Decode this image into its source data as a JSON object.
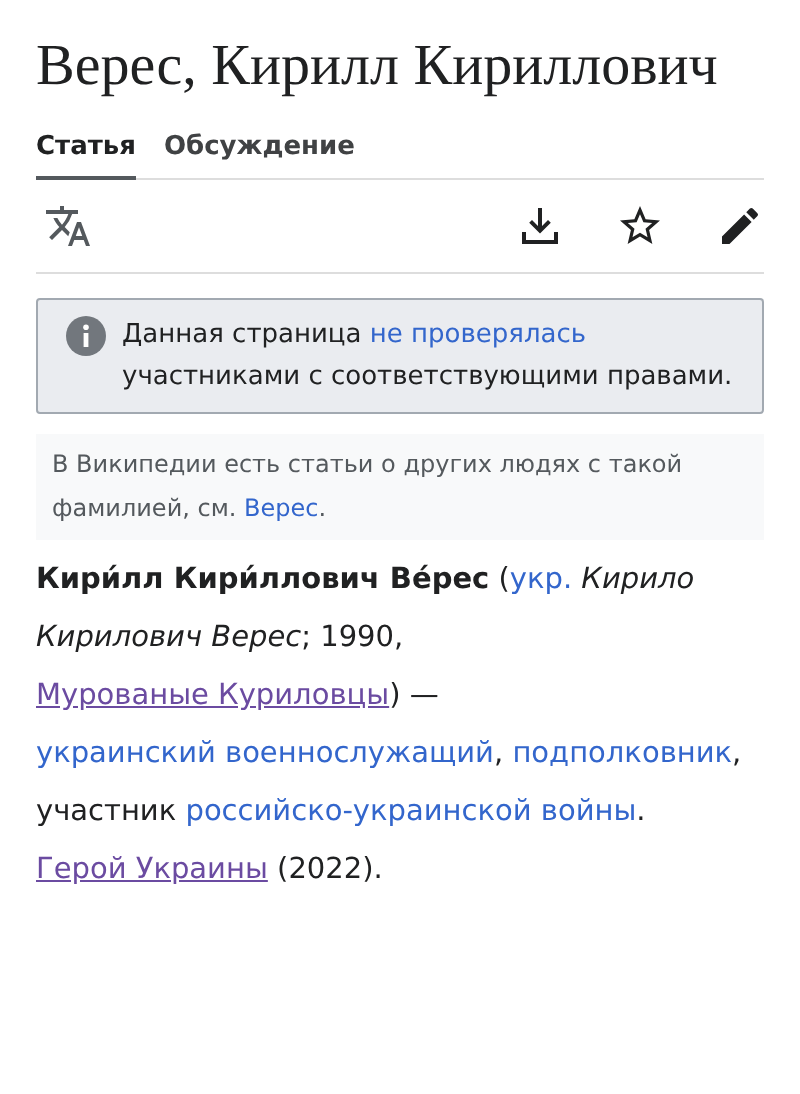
{
  "title": "Верес, Кирилл Кириллович",
  "tabs": [
    {
      "label": "Статья",
      "selected": true
    },
    {
      "label": "Обсуждение",
      "selected": false
    }
  ],
  "notice": [
    {
      "kind": "text",
      "text": "Данная страница "
    },
    {
      "kind": "link",
      "text": "не проверялась"
    },
    {
      "kind": "text",
      "text": " участниками с соответствующими правами."
    }
  ],
  "hatnote": [
    {
      "kind": "text",
      "text": "В Википедии есть статьи о других людях с такой фамилией, см. "
    },
    {
      "kind": "link",
      "text": "Верес"
    },
    {
      "kind": "text",
      "text": "."
    }
  ],
  "lead": [
    {
      "kind": "bold",
      "text": "Кири́лл Кири́ллович Ве́рес"
    },
    {
      "kind": "text",
      "text": " ("
    },
    {
      "kind": "link",
      "text": "укр."
    },
    {
      "kind": "italic",
      "text": " Кирило Кирилович Верес"
    },
    {
      "kind": "text",
      "text": "; 1990, "
    },
    {
      "kind": "visited",
      "text": "Мурованые Куриловцы"
    },
    {
      "kind": "text",
      "text": ") — "
    },
    {
      "kind": "link",
      "text": "украинский военнослужащий"
    },
    {
      "kind": "text",
      "text": ", "
    },
    {
      "kind": "link",
      "text": "подполковник"
    },
    {
      "kind": "text",
      "text": ", участник "
    },
    {
      "kind": "link",
      "text": "российско-украинской войны"
    },
    {
      "kind": "text",
      "text": ". "
    },
    {
      "kind": "visited",
      "text": "Герой Украины"
    },
    {
      "kind": "text",
      "text": " (2022)."
    }
  ]
}
